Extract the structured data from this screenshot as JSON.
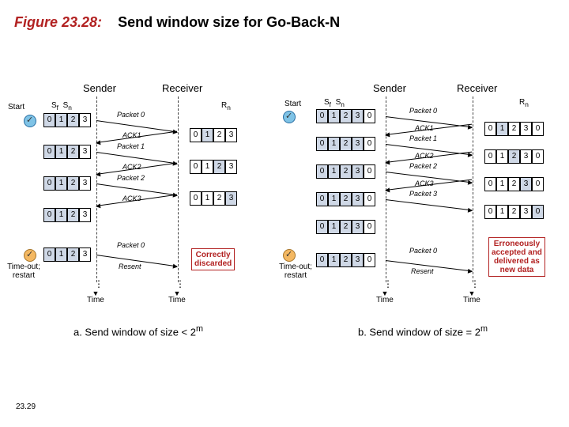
{
  "title": {
    "figureLabel": "Figure 23.28:",
    "figureText": "Send window size for Go-Back-N"
  },
  "pageNumber": "23.29",
  "labels": {
    "sender": "Sender",
    "receiver": "Receiver",
    "start": "Start",
    "timeoutRestart": "Time-out;\nrestart",
    "time": "Time",
    "sf": "S",
    "sfSub": "f",
    "sn": "S",
    "snSub": "n",
    "rn": "R",
    "rnSub": "n",
    "resent": "Resent"
  },
  "packets": {
    "p0": "Packet 0",
    "p1": "Packet 1",
    "p2": "Packet 2",
    "p3": "Packet 3",
    "a1": "ACK1",
    "a2": "ACK2",
    "a3": "ACK3"
  },
  "callouts": {
    "correctly": "Correctly\ndiscarded",
    "erroneous": "Erroneously\naccepted and\ndelivered as\nnew data"
  },
  "captions": {
    "a": "a. Send window of size < 2",
    "aExp": "m",
    "b": "b. Send window of size = 2",
    "bExp": "m"
  },
  "windows": {
    "fourSeq": [
      "0",
      "1",
      "2",
      "3"
    ],
    "fiveSeq": [
      "0",
      "1",
      "2",
      "3",
      "0"
    ]
  }
}
